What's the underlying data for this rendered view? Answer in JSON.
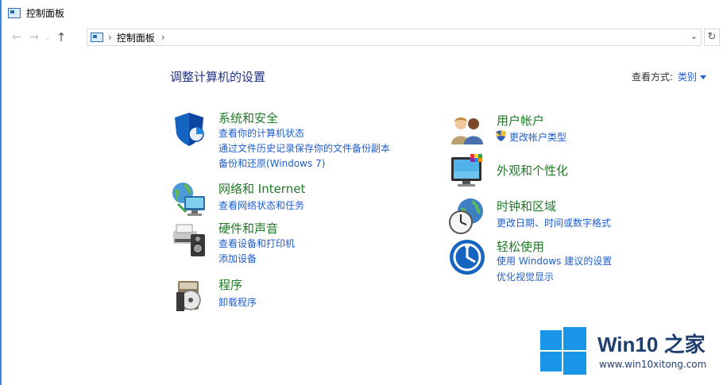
{
  "window": {
    "title": "控制面板"
  },
  "nav": {
    "back": "←",
    "forward": "→",
    "recent": "⌄",
    "up": "↑",
    "breadcrumb": [
      "控制面板"
    ],
    "breadcrumb_sep": "›",
    "dropdown": "⌄",
    "refresh": "↻"
  },
  "content": {
    "heading": "调整计算机的设置",
    "view_by_label": "查看方式:",
    "view_by_value": "类别"
  },
  "categories": [
    {
      "title": "系统和安全",
      "icon": "shield-icon",
      "links": [
        "查看你的计算机状态",
        "通过文件历史记录保存你的文件备份副本",
        "备份和还原(Windows 7)"
      ]
    },
    {
      "title": "网络和 Internet",
      "icon": "network-globe-icon",
      "links": [
        "查看网络状态和任务"
      ]
    },
    {
      "title": "硬件和声音",
      "icon": "printer-speaker-icon",
      "links": [
        "查看设备和打印机",
        "添加设备"
      ]
    },
    {
      "title": "程序",
      "icon": "programs-disc-icon",
      "links": [
        "卸载程序"
      ]
    },
    {
      "title": "用户帐户",
      "icon": "users-icon",
      "links": [
        "更改帐户类型"
      ]
    },
    {
      "title": "外观和个性化",
      "icon": "monitor-colors-icon",
      "links": []
    },
    {
      "title": "时钟和区域",
      "icon": "clock-globe-icon",
      "links": [
        "更改日期、时间或数字格式"
      ]
    },
    {
      "title": "轻松使用",
      "icon": "ease-of-access-icon",
      "links": [
        "使用 Windows 建议的设置",
        "优化视觉显示"
      ]
    }
  ],
  "watermark": {
    "brand": "Win10",
    "brand_suffix": "之家",
    "url": "www.win10xitong.com"
  },
  "colors": {
    "category_title": "#1f7a26",
    "link": "#1e5ecf",
    "heading": "#1e3287",
    "win_blue": "#1a96e8"
  }
}
